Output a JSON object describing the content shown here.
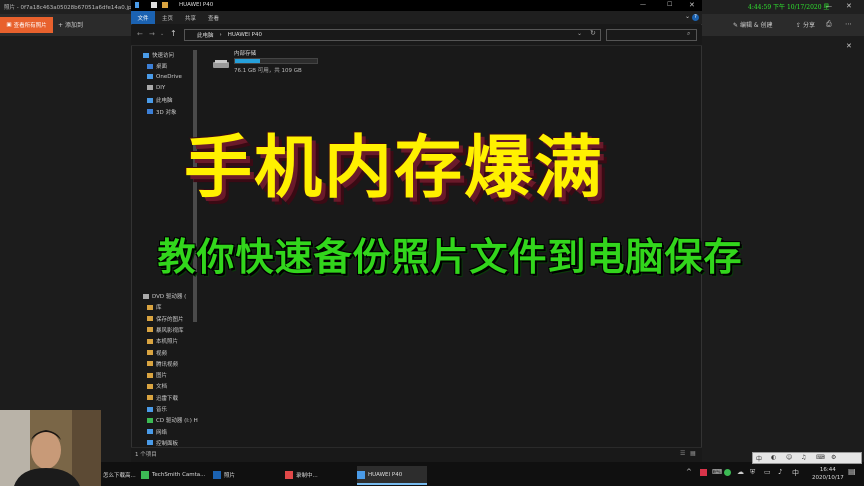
{
  "photos": {
    "title": "照片 - 0f7a18c463a05028b67051a6dfe14a0.jpg",
    "view_all": "查看所有照片",
    "add": "添加到",
    "edit_create": "编辑 & 创建",
    "share": "分享",
    "clock": "4:44:59 下午 10/17/2020 星"
  },
  "explorer": {
    "title": "HUAWEI P40",
    "ribbon": {
      "file": "文件",
      "home": "主页",
      "share": "共享",
      "view": "查看"
    },
    "address": {
      "root": "此电脑",
      "current": "HUAWEI P40"
    },
    "nav": [
      {
        "label": "快速访问",
        "color": "#4a9be8"
      },
      {
        "label": "桌面",
        "color": "#3c7fd6"
      },
      {
        "label": "OneDrive",
        "color": "#4a9be8"
      },
      {
        "label": "DIY",
        "color": "#aaaaaa"
      },
      {
        "label": "此电脑",
        "color": "#4a9be8"
      },
      {
        "label": "3D 对象",
        "color": "#3c7fd6"
      }
    ],
    "nav_lower": [
      {
        "label": "DVD 驱动器 (",
        "color": "#aaaaaa"
      },
      {
        "label": "库",
        "color": "#d9a441"
      },
      {
        "label": "保存的图片",
        "color": "#d9a441"
      },
      {
        "label": "暴风影视库",
        "color": "#d9a441"
      },
      {
        "label": "本机照片",
        "color": "#d9a441"
      },
      {
        "label": "视频",
        "color": "#d9a441"
      },
      {
        "label": "腾讯视频",
        "color": "#d9a441"
      },
      {
        "label": "图片",
        "color": "#d9a441"
      },
      {
        "label": "文档",
        "color": "#d9a441"
      },
      {
        "label": "迅雷下载",
        "color": "#d9a441"
      },
      {
        "label": "音乐",
        "color": "#4a9be8"
      },
      {
        "label": "CD 驱动器 (I:) H",
        "color": "#3cba54"
      },
      {
        "label": "网络",
        "color": "#4a9be8"
      },
      {
        "label": "控制面板",
        "color": "#4a9be8"
      },
      {
        "label": "回收站",
        "color": "#aaaaaa"
      }
    ],
    "drive": {
      "name": "内部存储",
      "space": "76.1 GB 可用，共 109 GB",
      "used_fraction": 0.3
    },
    "status": "1 个项目"
  },
  "overlay": {
    "headline": "手机内存爆满",
    "subtitle": "教你快速备份照片文件到电脑保存"
  },
  "taskbar": {
    "items": [
      {
        "label": "怎么下载高..."
      },
      {
        "label": "TechSmith Camta..."
      },
      {
        "label": "照片"
      },
      {
        "label": "录制中..."
      },
      {
        "label": "HUAWEI P40"
      }
    ],
    "time": "16:44",
    "date": "2020/10/17"
  }
}
